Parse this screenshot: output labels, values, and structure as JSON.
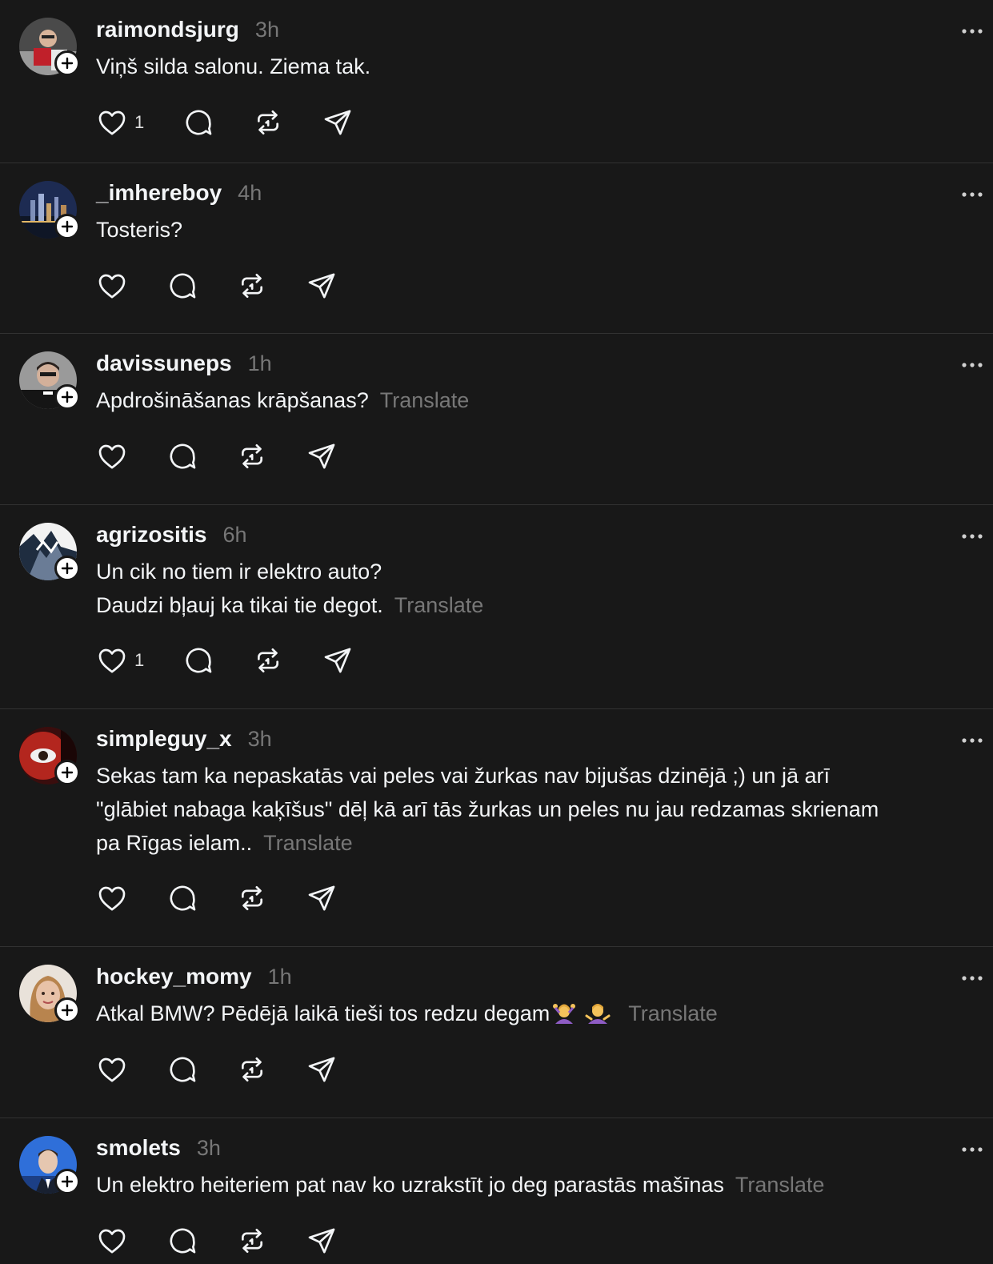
{
  "translate_label": "Translate",
  "posts": [
    {
      "username": "raimondsjurg",
      "time": "3h",
      "lines": [
        "Viņš silda salonu. Ziema tak."
      ],
      "translate": false,
      "likes": "1",
      "emojis": []
    },
    {
      "username": "_imhereboy",
      "time": "4h",
      "lines": [
        "Tosteris?"
      ],
      "translate": false,
      "likes": "",
      "emojis": []
    },
    {
      "username": "davissuneps",
      "time": "1h",
      "lines": [
        "Apdrošināšanas krāpšanas?"
      ],
      "translate": true,
      "likes": "",
      "emojis": []
    },
    {
      "username": "agrizositis",
      "time": "6h",
      "lines": [
        "Un cik no tiem ir elektro auto?",
        "Daudzi bļauj ka tikai tie degot."
      ],
      "translate": true,
      "likes": "1",
      "emojis": []
    },
    {
      "username": "simpleguy_x",
      "time": "3h",
      "lines": [
        "Sekas tam ka nepaskatās vai peles vai žurkas nav bijušas dzinējā ;) un jā arī",
        "\"glābiet nabaga kaķīšus\" dēļ kā arī tās žurkas un peles nu jau redzamas skrienam",
        "pa Rīgas ielam.."
      ],
      "translate": true,
      "likes": "",
      "emojis": []
    },
    {
      "username": "hockey_momy",
      "time": "1h",
      "lines": [
        "Atkal BMW? Pēdējā laikā tieši tos redzu degam"
      ],
      "translate": true,
      "likes": "",
      "emojis": [
        "woman-gesturing-ok-emoji",
        "woman-shrugging-emoji"
      ]
    },
    {
      "username": "smolets",
      "time": "3h",
      "lines": [
        "Un elektro heiteriem pat nav ko uzrakstīt jo deg parastās mašīnas"
      ],
      "translate": true,
      "likes": "",
      "emojis": []
    }
  ],
  "colors": {
    "background": "#181818",
    "text": "#f3f5f7",
    "muted": "#777777",
    "divider": "#323232"
  },
  "icons": [
    "heart-icon",
    "comment-icon",
    "repost-icon",
    "share-icon",
    "more-icon",
    "plus-icon"
  ]
}
